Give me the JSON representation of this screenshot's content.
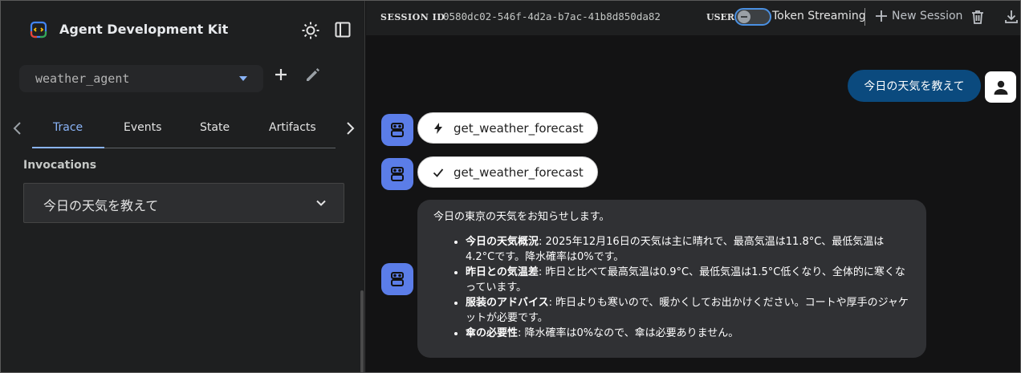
{
  "app": {
    "title": "Agent Development Kit",
    "icons": {
      "logo": "adk-logo-icon",
      "theme": "sun-icon",
      "panel": "sidebar-toggle-icon"
    }
  },
  "agent_selector": {
    "value": "weather_agent",
    "add_icon": "plus-icon",
    "edit_icon": "pencil-icon"
  },
  "tabs": [
    {
      "label": "Trace",
      "active": true
    },
    {
      "label": "Events",
      "active": false
    },
    {
      "label": "State",
      "active": false
    },
    {
      "label": "Artifacts",
      "active": false
    }
  ],
  "invocations": {
    "heading": "Invocations",
    "items": [
      {
        "text": "今日の天気を教えて",
        "expanded": false
      }
    ]
  },
  "topbar": {
    "session_label": "SESSION ID",
    "session_id": "0580dc02-546f-4d2a-b7ac-41b8d850da82",
    "user_label": "USER",
    "token_streaming_label": "Token Streaming",
    "token_streaming_on": false,
    "new_session_label": "New Session"
  },
  "chat": {
    "user_message": "今日の天気を教えて",
    "function_call": {
      "name": "get_weather_forecast",
      "icon": "bolt-icon"
    },
    "function_response": {
      "name": "get_weather_forecast",
      "icon": "check-icon"
    },
    "bot_reply": {
      "intro": "今日の東京の天気をお知らせします。",
      "bullets": [
        {
          "title": "今日の天気概況",
          "text": ": 2025年12月16日の天気は主に晴れで、最高気温は11.8°C、最低気温は4.2°Cです。降水確率は0%です。"
        },
        {
          "title": "昨日との気温差",
          "text": ": 昨日と比べて最高気温は0.9°C、最低気温は1.5°C低くなり、全体的に寒くなっています。"
        },
        {
          "title": "服装のアドバイス",
          "text": ": 昨日よりも寒いので、暖かくしてお出かけください。コートや厚手のジャケットが必要です。"
        },
        {
          "title": "傘の必要性",
          "text": ": 降水確率は0%なので、傘は必要ありません。"
        }
      ]
    }
  },
  "colors": {
    "accent": "#8ab4f8",
    "user_bubble": "#0b4a7e",
    "bot_avatar": "#5b7de8",
    "bot_bubble": "#303134"
  }
}
